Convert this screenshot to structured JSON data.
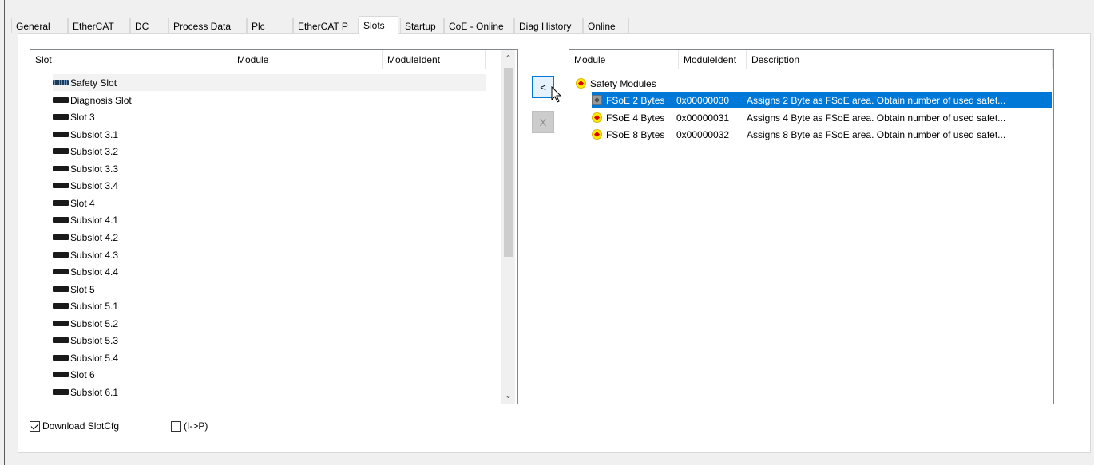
{
  "tabs": [
    {
      "label": "General",
      "active": false
    },
    {
      "label": "EtherCAT",
      "active": false
    },
    {
      "label": "DC",
      "active": false
    },
    {
      "label": "Process Data",
      "active": false
    },
    {
      "label": "Plc",
      "active": false
    },
    {
      "label": "EtherCAT P",
      "active": false
    },
    {
      "label": "Slots",
      "active": true
    },
    {
      "label": "Startup",
      "active": false
    },
    {
      "label": "CoE - Online",
      "active": false
    },
    {
      "label": "Diag History",
      "active": false
    },
    {
      "label": "Online",
      "active": false
    }
  ],
  "slots_list": {
    "columns": [
      "Slot",
      "Module",
      "ModuleIdent"
    ],
    "rows": [
      "Safety Slot",
      "Diagnosis Slot",
      "Slot 3",
      "Subslot 3.1",
      "Subslot 3.2",
      "Subslot 3.3",
      "Subslot 3.4",
      "Slot 4",
      "Subslot 4.1",
      "Subslot 4.2",
      "Subslot 4.3",
      "Subslot 4.4",
      "Slot 5",
      "Subslot 5.1",
      "Subslot 5.2",
      "Subslot 5.3",
      "Subslot 5.4",
      "Slot 6",
      "Subslot 6.1"
    ]
  },
  "buttons": {
    "add": "<",
    "remove": "X"
  },
  "modules_list": {
    "columns": [
      "Module",
      "ModuleIdent",
      "Description"
    ],
    "group": "Safety Modules",
    "rows": [
      {
        "module": "FSoE 2 Bytes",
        "ident": "0x00000030",
        "description": "Assigns 2 Byte as FSoE area. Obtain number of used safet...",
        "selected": true
      },
      {
        "module": "FSoE 4 Bytes",
        "ident": "0x00000031",
        "description": "Assigns 4 Byte as FSoE area. Obtain number of used safet...",
        "selected": false
      },
      {
        "module": "FSoE 8 Bytes",
        "ident": "0x00000032",
        "description": "Assigns 8 Byte as FSoE area. Obtain number of used safet...",
        "selected": false
      }
    ]
  },
  "options": {
    "download_slotcfg": {
      "label": "Download SlotCfg",
      "checked": true
    },
    "i_to_p": {
      "label": "(I->P)",
      "checked": false
    }
  },
  "colors": {
    "selection": "#0078d7",
    "module_icon": "#ffea00"
  }
}
